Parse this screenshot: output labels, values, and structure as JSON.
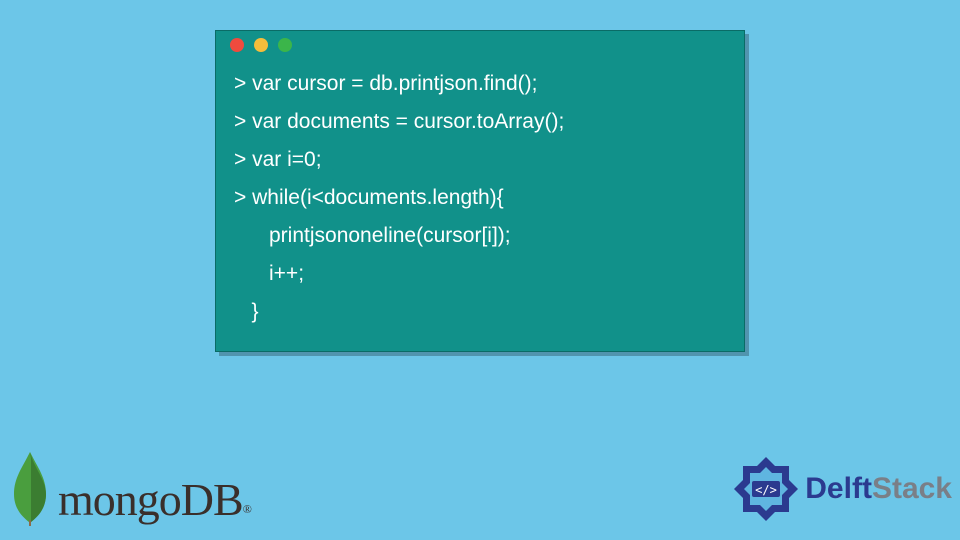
{
  "code": {
    "lines": [
      "> var cursor = db.printjson.find();",
      "> var documents = cursor.toArray();",
      "> var i=0;",
      "> while(i<documents.length){",
      "      printjsononeline(cursor[i]);",
      "      i++;",
      "   }"
    ]
  },
  "logos": {
    "mongo": {
      "text": "mongoDB",
      "reg": "®"
    },
    "delft": {
      "part1": "Delft",
      "part2": "Stack"
    }
  },
  "colors": {
    "bg": "#6cc6e8",
    "window": "#11918a",
    "dot_red": "#ef4b3e",
    "dot_yellow": "#f6bd3b",
    "dot_green": "#3bb54a"
  }
}
